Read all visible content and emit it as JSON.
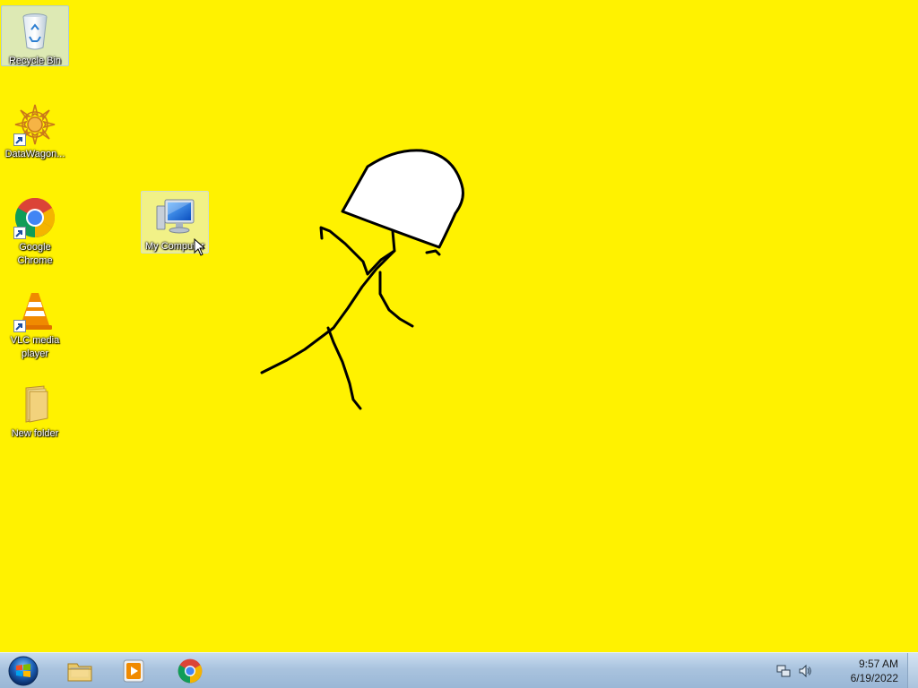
{
  "desktop": {
    "background_color": "#fff200",
    "icons": [
      {
        "label": "Recycle Bin",
        "icon": "recycle-bin-icon",
        "shortcut": false
      },
      {
        "label": "DataWagon...",
        "icon": "datawagon-icon",
        "shortcut": true
      },
      {
        "label": "Google Chrome",
        "icon": "chrome-icon",
        "shortcut": true
      },
      {
        "label": "VLC media player",
        "icon": "vlc-icon",
        "shortcut": true
      },
      {
        "label": "New folder",
        "icon": "folder-icon",
        "shortcut": false
      },
      {
        "label": "My Computer",
        "icon": "computer-icon",
        "shortcut": false
      }
    ]
  },
  "taskbar": {
    "start": {
      "icon": "windows-start-icon"
    },
    "pinned": [
      {
        "name": "Windows Explorer",
        "icon": "explorer-icon"
      },
      {
        "name": "Windows Media Player",
        "icon": "media-player-icon"
      },
      {
        "name": "Google Chrome",
        "icon": "chrome-icon"
      }
    ],
    "tray": {
      "network_icon": "network-icon",
      "volume_icon": "volume-icon",
      "time": "9:57 AM",
      "date": "6/19/2022"
    }
  }
}
